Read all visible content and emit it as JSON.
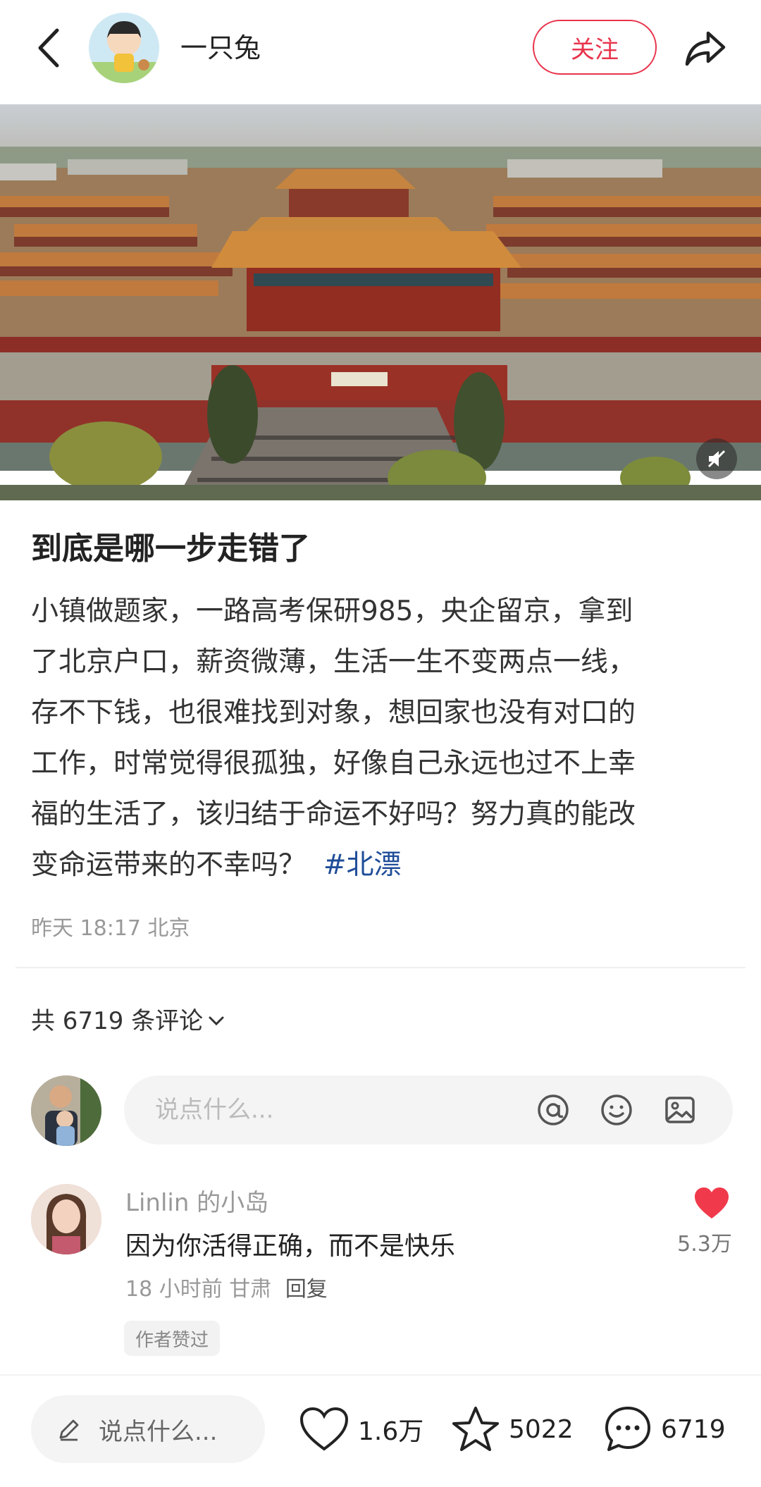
{
  "header": {
    "author_name": "一只兔",
    "follow_label": "关注"
  },
  "post": {
    "title": "到底是哪一步走错了",
    "body_lines": [
      "小镇做题家，一路高考保研985，央企留京，拿到",
      "了北京户口，薪资微薄，生活一生不变两点一线，",
      "存不下钱，也很难找到对象，想回家也没有对口的",
      "工作，时常觉得很孤独，好像自己永远也过不上幸",
      "福的生活了，该归结于命运不好吗？努力真的能改",
      "变命运带来的不幸吗？"
    ],
    "hashtag": "#北漂",
    "meta": "昨天 18:17 北京"
  },
  "comments_section": {
    "count_label": "共 6719 条评论",
    "input_placeholder": "说点什么...",
    "items": [
      {
        "user": "Linlin 的小岛",
        "text": "因为你活得正确，而不是快乐",
        "time": "18 小时前",
        "location": "甘肃",
        "reply_label": "回复",
        "badge": "作者赞过",
        "likes": "5.3万",
        "liked": true
      }
    ]
  },
  "bottom_bar": {
    "input_placeholder": "说点什么...",
    "like_count": "1.6万",
    "collect_count": "5022",
    "comment_count": "6719"
  },
  "colors": {
    "accent": "#e8344c",
    "hashtag": "#1f4d99"
  },
  "icons": [
    "back-icon",
    "share-icon",
    "mute-icon",
    "chevron-down-icon",
    "at-icon",
    "emoji-icon",
    "image-icon",
    "heart-filled-icon",
    "pen-icon",
    "heart-icon",
    "star-icon",
    "chat-bubble-icon"
  ]
}
